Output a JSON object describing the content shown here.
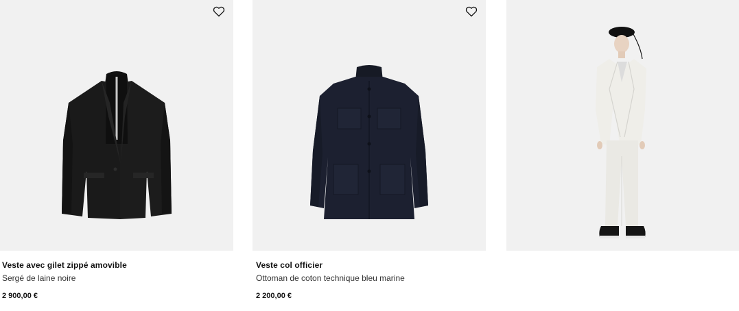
{
  "products": [
    {
      "name": "Veste avec gilet zippé amovible",
      "material": "Sergé de laine noire",
      "price": "2 900,00 €",
      "image": "black-jacket-with-zip-gilet"
    },
    {
      "name": "Veste col officier",
      "material": "Ottoman de coton technique bleu marine",
      "price": "2 200,00 €",
      "image": "navy-officer-collar-jacket"
    },
    {
      "image": "model-in-white-suit-and-black-beret"
    }
  ],
  "icons": {
    "wishlist": "heart-outline-icon"
  },
  "colors": {
    "image_background": "#f1f1f1",
    "jacket_black": "#151515",
    "jacket_navy": "#1b1f2c",
    "suit_white": "#ecebe6"
  }
}
